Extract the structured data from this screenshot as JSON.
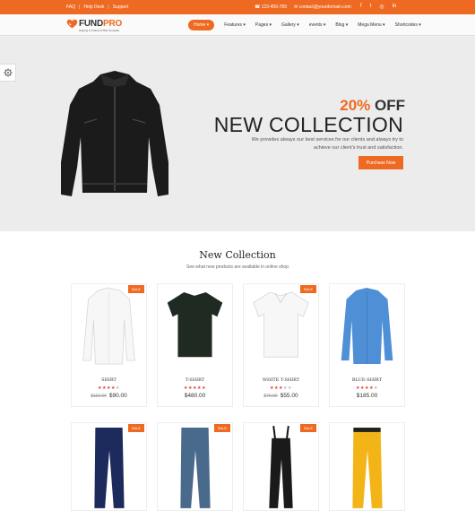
{
  "topbar": {
    "faq": "FAQ",
    "help": "Help Desk",
    "support": "Support",
    "sep": "|",
    "phone": "123-456-789",
    "email": "contact@yourdomain.com",
    "social_icons": [
      "facebook-icon",
      "twitter-icon",
      "instagram-icon",
      "linkedin-icon"
    ]
  },
  "brand": {
    "name_a": "FUND",
    "name_b": "PRO",
    "tagline": "Helping & Charity HTML Template",
    "accent": "#ee6a22"
  },
  "nav": {
    "items": [
      {
        "label": "Home ▾",
        "active": true
      },
      {
        "label": "Features ▾"
      },
      {
        "label": "Pages ▾"
      },
      {
        "label": "Gallery ▾"
      },
      {
        "label": "events ▾"
      },
      {
        "label": "Blog ▾"
      },
      {
        "label": "Mega Menu ▾"
      },
      {
        "label": "Shortcodes ▾"
      }
    ]
  },
  "hero": {
    "percent": "20%",
    "off": "OFF",
    "title": "NEW COLLECTION",
    "description": "We provides always our best services for our clients and always try to achieve our client's trust and satisfaction.",
    "button": "Purchase Now"
  },
  "section": {
    "title": "New Collection",
    "subtitle": "See what new products are available in online shop"
  },
  "products_row1": [
    {
      "name": "Shirt",
      "stars": 4,
      "old_price": "$110.00",
      "price": "$90.00",
      "sale": "SALE"
    },
    {
      "name": "T-Shirt",
      "stars": 5,
      "old_price": "",
      "price": "$480.00",
      "sale": ""
    },
    {
      "name": "White T-Shirt",
      "stars": 3,
      "old_price": "$70.00",
      "price": "$55.00",
      "sale": "SALE"
    },
    {
      "name": "Blue-Shirt",
      "stars": 4,
      "old_price": "",
      "price": "$185.00",
      "sale": ""
    }
  ],
  "products_row2": [
    {
      "sale": "SALE"
    },
    {
      "sale": "SALE"
    },
    {
      "sale": "SALE"
    },
    {
      "sale": ""
    }
  ]
}
